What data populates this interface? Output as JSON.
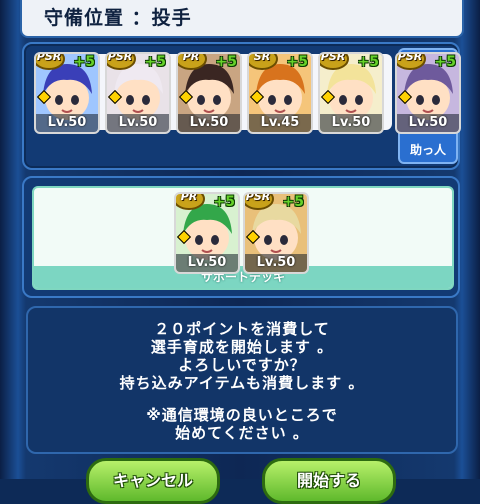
{
  "header": {
    "title": "守備位置 ：投手"
  },
  "deck": {
    "cards": [
      {
        "rank": "PSR",
        "bonus": "+5",
        "level": "Lv.50",
        "icon": "boy-blue-cap-portrait",
        "bg": "#9fc6ff",
        "hair": "#3a3fb8"
      },
      {
        "rank": "PSR",
        "bonus": "+5",
        "level": "Lv.50",
        "icon": "boy-white-hair-portrait",
        "bg": "#e9e2e8",
        "hair": "#efe9f1"
      },
      {
        "rank": "PR",
        "bonus": "+5",
        "level": "Lv.50",
        "icon": "girl-pink-mask-portrait",
        "bg": "#c9a582",
        "hair": "#3a2622"
      },
      {
        "rank": "SR",
        "bonus": "+5",
        "level": "Lv.45",
        "icon": "boy-orange-hair-portrait",
        "bg": "#f5c57a",
        "hair": "#d8731d"
      },
      {
        "rank": "PSR",
        "bonus": "+5",
        "level": "Lv.50",
        "icon": "girl-blonde-portrait",
        "bg": "#f5eecc",
        "hair": "#f3e39a"
      }
    ],
    "helper": {
      "rank": "PSR",
      "bonus": "+5",
      "level": "Lv.50",
      "label": "助っ人",
      "icon": "girl-purple-hair-portrait",
      "bg": "#c6b7df",
      "hair": "#6e5a9c"
    }
  },
  "support": {
    "cards": [
      {
        "rank": "PR",
        "bonus": "+5",
        "level": "Lv.50",
        "icon": "green-frog-helmet-portrait",
        "bg": "#d8f1d0",
        "hair": "#33a74a"
      },
      {
        "rank": "PSR",
        "bonus": "+5",
        "level": "Lv.50",
        "icon": "dark-skin-bandana-portrait",
        "bg": "#e9c07a",
        "hair": "#e8d9a0"
      }
    ],
    "label": "サポートデッキ"
  },
  "message": {
    "lines": [
      "２０ポイントを消費して",
      "選手育成を開始します 。",
      "よろしいですか？",
      "持ち込みアイテムも消費します 。",
      "",
      "※通信環境の良いところで",
      "始めてください 。"
    ]
  },
  "buttons": {
    "cancel": "キャンセル",
    "start": "開始する"
  }
}
